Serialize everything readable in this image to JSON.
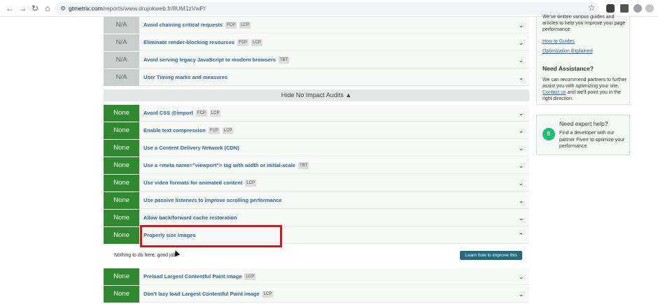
{
  "browser": {
    "url_host": "gtmetrix.com",
    "url_path": "/reports/www.drujokweb.fr/8UM1zVwP/"
  },
  "audits_top": [
    {
      "score": "N/A",
      "title": "Avoid chaining critical requests",
      "tags": [
        "FCP",
        "LCP"
      ]
    },
    {
      "score": "N/A",
      "title": "Eliminate render-blocking resources",
      "tags": [
        "FCP",
        "LCP"
      ]
    },
    {
      "score": "N/A",
      "title": "Avoid serving legacy JavaScript to modern browsers",
      "tags": [
        "TBT"
      ]
    },
    {
      "score": "N/A",
      "title": "User Timing marks and measures",
      "tags": []
    }
  ],
  "hide_label": "Hide No Impact Audits",
  "audits_none": [
    {
      "score": "None",
      "title": "Avoid CSS @import",
      "tags": [
        "FCP",
        "LCP"
      ]
    },
    {
      "score": "None",
      "title": "Enable text compression",
      "tags": [
        "FCP",
        "LCP"
      ]
    },
    {
      "score": "None",
      "title": "Use a Content Delivery Network (CDN)",
      "tags": []
    },
    {
      "score": "None",
      "title": "Use a <meta name=\"viewport\"> tag with width or initial-scale",
      "tags": [
        "TBT"
      ]
    },
    {
      "score": "None",
      "title": "Use video formats for animated content",
      "tags": [
        "LCP"
      ]
    },
    {
      "score": "None",
      "title": "Use passive listeners to improve scrolling performance",
      "tags": []
    },
    {
      "score": "None",
      "title": "Allow back/forward cache restoration",
      "tags": []
    },
    {
      "score": "None",
      "title": "Properly size images",
      "tags": []
    }
  ],
  "detail": {
    "text": "Nothing to do here, good job!",
    "button": "Learn how to improve this"
  },
  "audits_bottom": [
    {
      "score": "None",
      "title": "Preload Largest Contentful Paint image",
      "tags": [
        "LCP"
      ]
    },
    {
      "score": "None",
      "title": "Don't lazy load Largest Contentful Paint image",
      "tags": [
        "LCP"
      ]
    }
  ],
  "sidebar": {
    "guides_text": "We've written various guides and articles to help you improve your page performance:",
    "link_how_to": "How to Guides",
    "link_optimization": "Optimization Explained",
    "assist_title": "Need Assistance?",
    "assist_text_1": "We can recommend partners to further assist you with optimizing your site.",
    "assist_link": "Contact us",
    "assist_text_2": "and we'll point you in the right direction.",
    "expert_title": "Need expert help?",
    "expert_text": "Find a developer with our partner Fiverr to optimize your performance",
    "fiverr_glyph": "fi"
  }
}
